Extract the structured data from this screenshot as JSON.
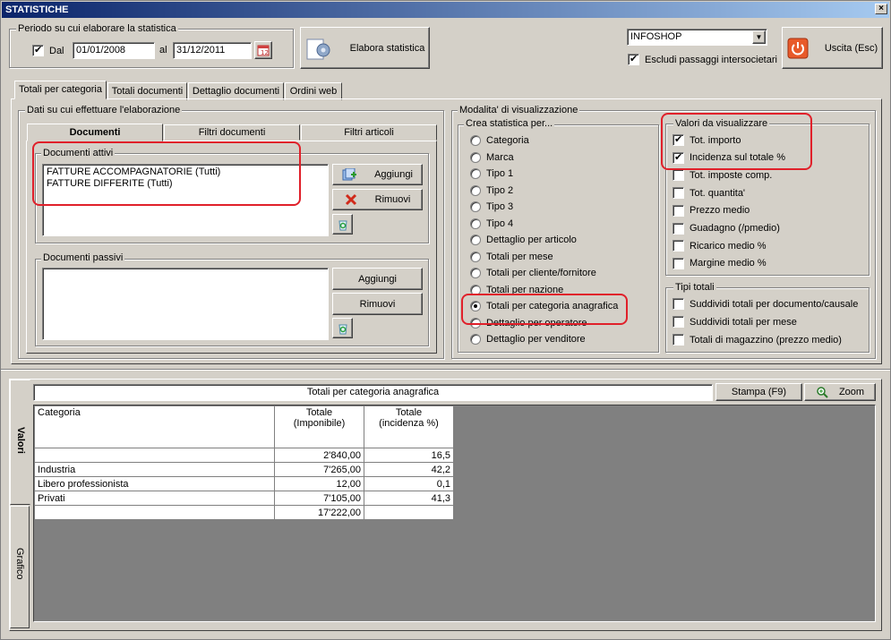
{
  "window": {
    "title": "STATISTICHE",
    "close": "×"
  },
  "period": {
    "group_label": "Periodo su cui elaborare la statistica",
    "dal_label": "Dal",
    "dal_checked": true,
    "date_from": "01/01/2008",
    "al_label": "al",
    "date_to": "31/12/2011"
  },
  "elabora_button": "Elabora statistica",
  "company_select": {
    "value": "INFOSHOP"
  },
  "exclude_intercompany": {
    "label": "Escludi passaggi intersocietari",
    "checked": true
  },
  "exit_button": "Uscita (Esc)",
  "main_tabs": [
    "Totali per categoria",
    "Totali documenti",
    "Dettaglio documenti",
    "Ordini web"
  ],
  "data_group": {
    "label": "Dati su cui effettuare l'elaborazione",
    "subtabs": [
      "Documenti",
      "Filtri documenti",
      "Filtri articoli"
    ],
    "active_docs": {
      "label": "Documenti attivi",
      "items": [
        "FATTURE ACCOMPAGNATORIE (Tutti)",
        "FATTURE DIFFERITE (Tutti)"
      ],
      "add": "Aggiungi",
      "remove": "Rimuovi"
    },
    "passive_docs": {
      "label": "Documenti passivi",
      "items": [],
      "add": "Aggiungi",
      "remove": "Rimuovi"
    }
  },
  "view_mode": {
    "label": "Modalita' di visualizzazione",
    "create_by": {
      "label": "Crea statistica per...",
      "options": [
        "Categoria",
        "Marca",
        "Tipo 1",
        "Tipo 2",
        "Tipo 3",
        "Tipo 4",
        "Dettaglio per articolo",
        "Totali per mese",
        "Totali per cliente/fornitore",
        "Totali per nazione",
        "Totali per categoria anagrafica",
        "Dettaglio per operatore",
        "Dettaglio per venditore"
      ],
      "selected": "Totali per categoria anagrafica"
    },
    "values": {
      "label": "Valori da visualizzare",
      "options": [
        {
          "label": "Tot. importo",
          "checked": true
        },
        {
          "label": "Incidenza sul totale %",
          "checked": true
        },
        {
          "label": "Tot. imposte comp.",
          "checked": false
        },
        {
          "label": "Tot. quantita'",
          "checked": false
        },
        {
          "label": "Prezzo medio",
          "checked": false
        },
        {
          "label": "Guadagno (/pmedio)",
          "checked": false
        },
        {
          "label": "Ricarico medio %",
          "checked": false
        },
        {
          "label": "Margine medio %",
          "checked": false
        }
      ]
    },
    "totals": {
      "label": "Tipi totali",
      "options": [
        {
          "label": "Suddividi totali per documento/causale",
          "checked": false
        },
        {
          "label": "Suddividi totali per mese",
          "checked": false
        },
        {
          "label": "Totali di magazzino (prezzo medio)",
          "checked": false
        }
      ]
    }
  },
  "results": {
    "title": "Totali per categoria anagrafica",
    "print_button": "Stampa (F9)",
    "zoom_button": "Zoom",
    "side_tabs": [
      "Valori",
      "Grafico"
    ],
    "table": {
      "headers": [
        "Categoria",
        "Totale\n(Imponibile)",
        "Totale\n(incidenza %)"
      ],
      "rows": [
        [
          "",
          "2'840,00",
          "16,5"
        ],
        [
          "Industria",
          "7'265,00",
          "42,2"
        ],
        [
          "Libero professionista",
          "12,00",
          "0,1"
        ],
        [
          "Privati",
          "7'105,00",
          "41,3"
        ],
        [
          "",
          "17'222,00",
          ""
        ]
      ]
    }
  }
}
